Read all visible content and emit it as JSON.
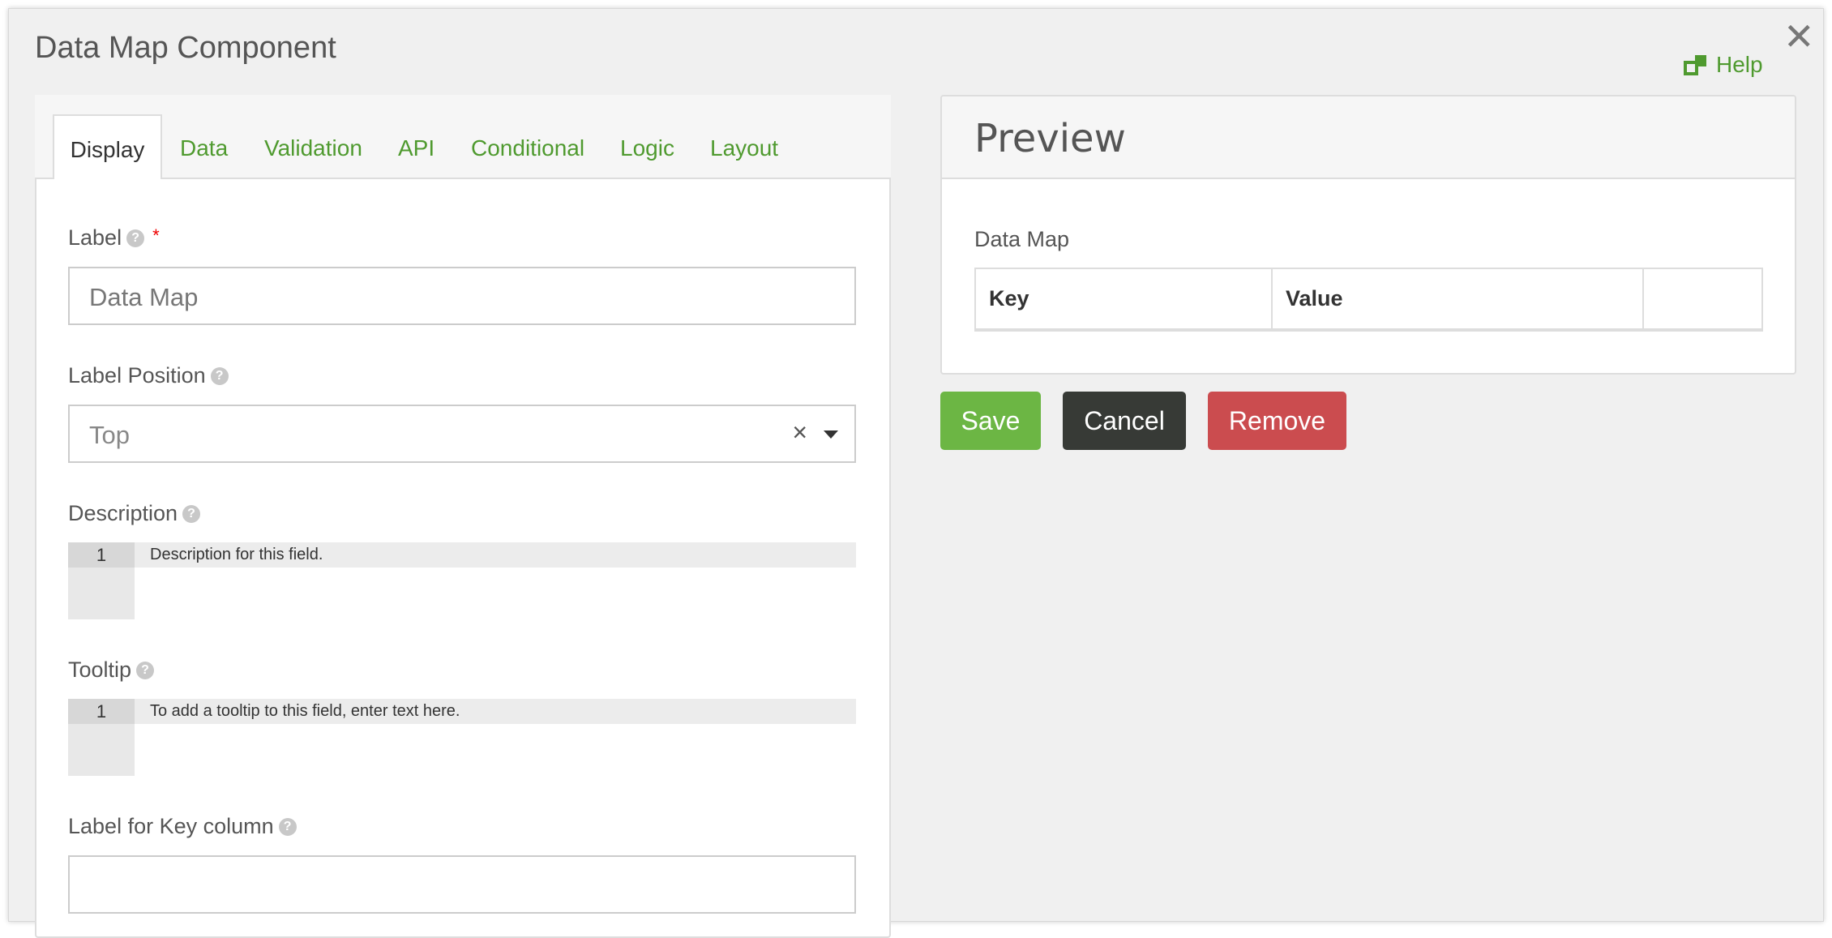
{
  "modal": {
    "title": "Data Map Component",
    "close_icon": "close-icon",
    "help_label": "Help",
    "help_icon": "external-link-icon"
  },
  "tabs": [
    {
      "label": "Display",
      "active": true
    },
    {
      "label": "Data"
    },
    {
      "label": "Validation"
    },
    {
      "label": "API"
    },
    {
      "label": "Conditional"
    },
    {
      "label": "Logic"
    },
    {
      "label": "Layout"
    }
  ],
  "form": {
    "label": {
      "label": "Label",
      "required_mark": "*",
      "value": "Data Map"
    },
    "label_position": {
      "label": "Label Position",
      "value": "Top",
      "clear": "×"
    },
    "description": {
      "label": "Description",
      "line_number": "1",
      "placeholder": "Description for this field."
    },
    "tooltip": {
      "label": "Tooltip",
      "line_number": "1",
      "placeholder": "To add a tooltip to this field, enter text here."
    },
    "key_label": {
      "label": "Label for Key column",
      "value": ""
    }
  },
  "preview": {
    "title": "Preview",
    "field_label": "Data Map",
    "columns": [
      "Key",
      "Value",
      ""
    ]
  },
  "buttons": {
    "save": "Save",
    "cancel": "Cancel",
    "remove": "Remove"
  },
  "colors": {
    "accent": "#4f9a2f",
    "save": "#6cb644",
    "cancel": "#373a36",
    "remove": "#cb4c4f"
  }
}
